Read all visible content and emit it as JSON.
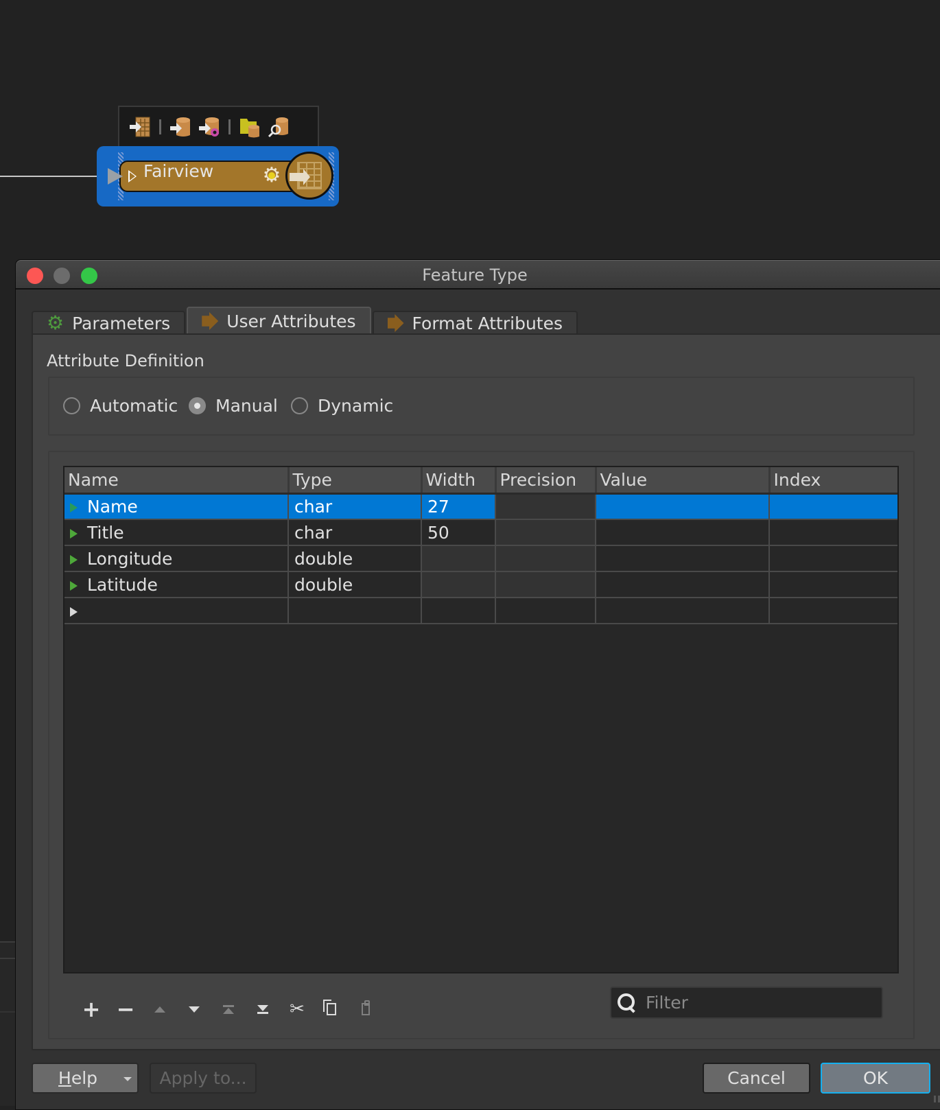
{
  "workspace": {
    "node": {
      "title": "Fairview",
      "toolbar_icons": [
        "table-reader-icon",
        "database-reader-icon",
        "database-transform-icon",
        "folder-database-icon",
        "database-inspect-icon"
      ]
    }
  },
  "dialog": {
    "title": "Feature Type",
    "tabs": [
      {
        "label": "Parameters",
        "icon": "gear-icon",
        "active": false
      },
      {
        "label": "User Attributes",
        "icon": "arrow-icon",
        "active": true
      },
      {
        "label": "Format Attributes",
        "icon": "arrow-icon",
        "active": false
      }
    ],
    "attribute_definition": {
      "label": "Attribute Definition",
      "options": [
        {
          "label": "Automatic",
          "checked": false
        },
        {
          "label": "Manual",
          "checked": true
        },
        {
          "label": "Dynamic",
          "checked": false
        }
      ]
    },
    "table": {
      "columns": [
        "Name",
        "Type",
        "Width",
        "Precision",
        "Value",
        "Index"
      ],
      "rows": [
        {
          "name": "Name",
          "type": "char",
          "width": "27",
          "precision": "",
          "value": "",
          "index": "",
          "selected": true
        },
        {
          "name": "Title",
          "type": "char",
          "width": "50",
          "precision": "",
          "value": "",
          "index": "",
          "selected": false
        },
        {
          "name": "Longitude",
          "type": "double",
          "width": "",
          "precision": "",
          "value": "",
          "index": "",
          "selected": false
        },
        {
          "name": "Latitude",
          "type": "double",
          "width": "",
          "precision": "",
          "value": "",
          "index": "",
          "selected": false
        },
        {
          "name": "",
          "type": "",
          "width": "",
          "precision": "",
          "value": "",
          "index": "",
          "selected": false
        }
      ]
    },
    "toolbar": {
      "add": "+",
      "remove": "−",
      "cut": "✂"
    },
    "filter": {
      "placeholder": "Filter",
      "value": ""
    },
    "buttons": {
      "help_first": "H",
      "help_rest": "elp",
      "apply": "Apply to...",
      "cancel": "Cancel",
      "ok": "OK"
    },
    "colors": {
      "selection": "#0178d4",
      "ok_focus": "#14b0f0",
      "node_body": "#a3762a",
      "node_selection": "#1769c5"
    }
  }
}
